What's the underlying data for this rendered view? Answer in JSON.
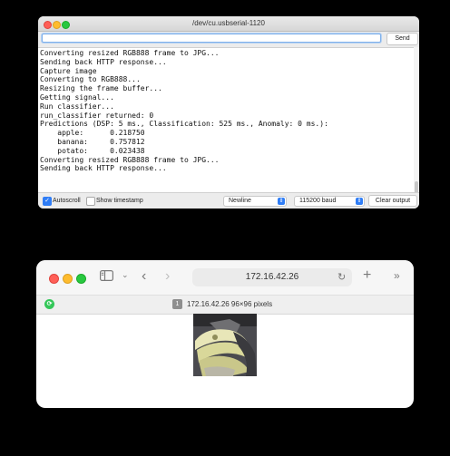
{
  "serial_monitor": {
    "title": "/dev/cu.usbserial-1120",
    "send_input_value": "",
    "send_label": "Send",
    "output_lines": [
      "Converting resized RGB888 frame to JPG...",
      "Sending back HTTP response...",
      "Capture image",
      "Converting to RGB888...",
      "Resizing the frame buffer...",
      "Getting signal...",
      "Run classifier...",
      "run_classifier returned: 0",
      "Predictions (DSP: 5 ms., Classification: 525 ms., Anomaly: 0 ms.):",
      "    apple:      0.218750",
      "    banana:     0.757812",
      "    potato:     0.023438",
      "Converting resized RGB888 frame to JPG...",
      "Sending back HTTP response..."
    ],
    "autoscroll_label": "Autoscroll",
    "autoscroll_checked": true,
    "timestamp_label": "Show timestamp",
    "timestamp_checked": false,
    "line_ending": "Newline",
    "baud_rate": "115200 baud",
    "clear_label": "Clear output",
    "accent_color": "#2f7df6"
  },
  "browser": {
    "url": "172.16.42.26",
    "tab_count": "1",
    "tab_title": "172.16.42.26 96×96 pixels",
    "extension_color": "#34c759"
  }
}
